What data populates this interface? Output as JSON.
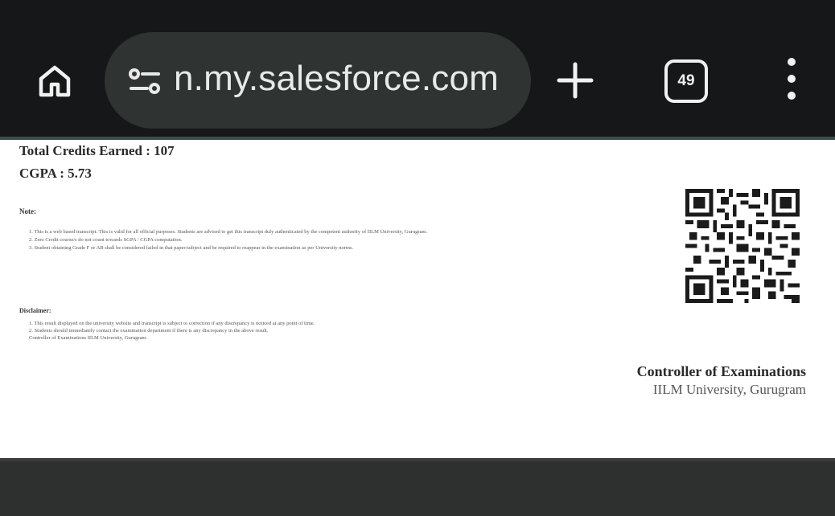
{
  "browser": {
    "url": "n.my.salesforce.com",
    "tab_count": "49",
    "icons": {
      "home": "home-icon",
      "site_settings": "tune-icon",
      "new_tab": "plus-icon",
      "tabs": "tab-switcher-icon",
      "menu": "more-vert-icon"
    },
    "colors": {
      "toolbar": "#161718",
      "url_bar": "#2f3332",
      "icon": "#f1f1f1"
    }
  },
  "document": {
    "total_credits": "Total Credits Earned : 107",
    "cgpa": "CGPA : 5.73",
    "notes_heading": "Note:",
    "notes": [
      "1. This is a web based transcript. This is valid for all official purposes. Students are advised to get this transcript duly authenticated by the competent authority of IILM University, Gurugram.",
      "2. Zero Credit course/s do not count towards SGPA / CGPA computation.",
      "3. Student obtaining Grade F or AB shall be considered failed in that paper/subject and be required to reappear in the examination as per University norms."
    ],
    "disclaimer_heading": "Disclaimer:",
    "disclaimers": [
      "1. This result displayed on the university website and transcript is subject to correction if any discrepancy is noticed at any point of time.",
      "2. Students should immediately contact the examination department if there is any discrepancy in the above result.",
      "Controller of Examinations IILM University, Gurugram."
    ],
    "signatory_title": "Controller of Examinations",
    "signatory_org": "IILM University, Gurugram"
  }
}
